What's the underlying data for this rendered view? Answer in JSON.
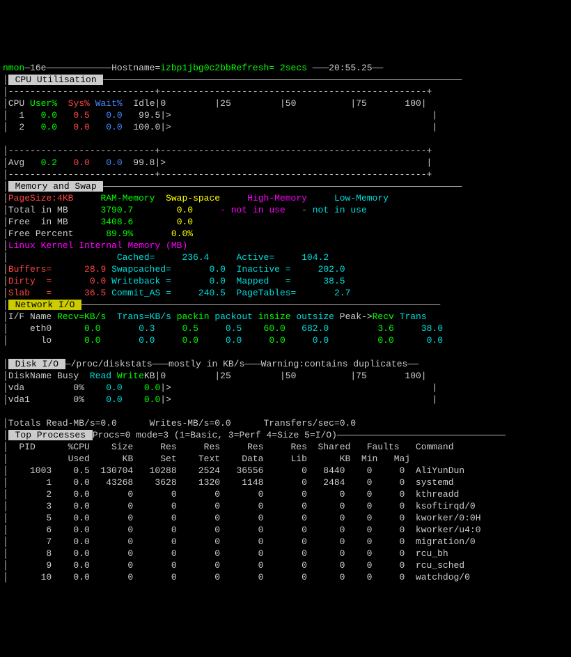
{
  "header": {
    "prog": "nmon",
    "ver": "—16e",
    "hostlabel": "Hostname=",
    "host": "izbp1jbg0c2bbRefresh= 2secs",
    "time": "20:55.25"
  },
  "cpu_box_title": " CPU Utilisation ",
  "cpu_cols": {
    "c1": "CPU",
    "c2": "User%",
    "c3": "Sys%",
    "c4": "Wait%",
    "c5": "Idle"
  },
  "cpu_rows": [
    {
      "cpu": "  1",
      "user": "0.0",
      "sys": "0.5",
      "wait": "0.0",
      "idle": "99.5"
    },
    {
      "cpu": "  2",
      "user": "0.0",
      "sys": "0.0",
      "wait": "0.0",
      "idle": "100.0"
    }
  ],
  "cpu_avg": {
    "label": "Avg",
    "user": "0.2",
    "sys": "0.0",
    "wait": "0.0",
    "idle": "99.8"
  },
  "cpu_scale": "|0         |25         |50          |75       100|",
  "mem_box_title": " Memory and Swap ",
  "mem": {
    "pagesize": "PageSize:4KB",
    "ram_label": "RAM-Memory",
    "swap_label": "Swap-space",
    "high_label": "High-Memory",
    "low_label": "Low-Memory",
    "total_label": "Total in MB",
    "total_ram": "3790.7",
    "total_swap": "0.0",
    "hnote": "- not in use",
    "lnote": "- not in use",
    "free_label": "Free  in MB",
    "free_ram": "3408.6",
    "free_swap": "0.0",
    "freep_label": "Free Percent",
    "freep_ram": "89.9%",
    "freep_swap": "0.0%",
    "kernel_label": "Linux Kernel Internal Memory (MB)",
    "cached_l": "Cached=",
    "cached_v": "236.4",
    "active_l": "Active=",
    "active_v": "104.2",
    "buffers_l": "Buffers=",
    "buffers_v": "28.9",
    "swapcached_l": "Swapcached=",
    "swapcached_v": "0.0",
    "inactive_l": "Inactive =",
    "inactive_v": "202.0",
    "dirty_l": "Dirty  =",
    "dirty_v": "0.0",
    "writeback_l": "Writeback =",
    "writeback_v": "0.0",
    "mapped_l": "Mapped   =",
    "mapped_v": "38.5",
    "slab_l": "Slab   =",
    "slab_v": "36.5",
    "commit_l": "Commit_AS =",
    "commit_v": "240.5",
    "pagetab_l": "PageTables=",
    "pagetab_v": "2.7"
  },
  "net_box_title": " Network I/O ",
  "net_cols": {
    "c1": "I/F Name",
    "c2": "Recv=KB/s",
    "c3": "Trans=KB/s",
    "c4": "packin",
    "c5": "packout",
    "c6": "insize",
    "c7": "outsize",
    "c8": "Peak->",
    "c9": "Recv",
    "c10": "Trans"
  },
  "net_rows": [
    {
      "if": "    eth0",
      "recv": "0.0",
      "trans": "0.3",
      "pin": "0.5",
      "pout": "0.5",
      "insz": "60.0",
      "outsz": "682.0",
      "precv": "3.6",
      "ptrans": "38.0"
    },
    {
      "if": "      lo",
      "recv": "0.0",
      "trans": "0.0",
      "pin": "0.0",
      "pout": "0.0",
      "insz": "0.0",
      "outsz": "0.0",
      "precv": "0.0",
      "ptrans": "0.0"
    }
  ],
  "disk_box_title": " Disk I/O ",
  "disk_suffix": "—/proc/diskstats———mostly in KB/s———Warning:contains duplicates——",
  "disk_cols": {
    "c1": "DiskName",
    "c2": "Busy",
    "c3": "Read",
    "c4": "Write",
    "c5": "KB"
  },
  "disk_rows": [
    {
      "name": "vda",
      "busy": "0%",
      "read": "0.0",
      "write": "0.0"
    },
    {
      "name": "vda1",
      "busy": "0%",
      "read": "0.0",
      "write": "0.0"
    }
  ],
  "disk_totals": "Totals Read-MB/s=0.0      Writes-MB/s=0.0      Transfers/sec=0.0",
  "proc_box_title": " Top Processes ",
  "proc_suffix": "Procs=0 mode=3 (1=Basic, 3=Perf 4=Size 5=I/O)",
  "proc_hdr1": "  PID      %CPU    Size     Res     Res     Res     Res  Shared   Faults   Command",
  "proc_hdr2": "           Used      KB     Set    Text    Data     Lib      KB  Min   Maj",
  "procs": [
    {
      "pid": "    1003",
      "cpu": "0.5",
      "size": "130704",
      "set": "10288",
      "text": "2524",
      "data": "36556",
      "lib": "0",
      "shared": "8440",
      "min": "0",
      "maj": "0",
      "cmd": "AliYunDun"
    },
    {
      "pid": "       1",
      "cpu": "0.0",
      "size": "43268",
      "set": "3628",
      "text": "1320",
      "data": "1148",
      "lib": "0",
      "shared": "2484",
      "min": "0",
      "maj": "0",
      "cmd": "systemd"
    },
    {
      "pid": "       2",
      "cpu": "0.0",
      "size": "0",
      "set": "0",
      "text": "0",
      "data": "0",
      "lib": "0",
      "shared": "0",
      "min": "0",
      "maj": "0",
      "cmd": "kthreadd"
    },
    {
      "pid": "       3",
      "cpu": "0.0",
      "size": "0",
      "set": "0",
      "text": "0",
      "data": "0",
      "lib": "0",
      "shared": "0",
      "min": "0",
      "maj": "0",
      "cmd": "ksoftirqd/0"
    },
    {
      "pid": "       5",
      "cpu": "0.0",
      "size": "0",
      "set": "0",
      "text": "0",
      "data": "0",
      "lib": "0",
      "shared": "0",
      "min": "0",
      "maj": "0",
      "cmd": "kworker/0:0H"
    },
    {
      "pid": "       6",
      "cpu": "0.0",
      "size": "0",
      "set": "0",
      "text": "0",
      "data": "0",
      "lib": "0",
      "shared": "0",
      "min": "0",
      "maj": "0",
      "cmd": "kworker/u4:0"
    },
    {
      "pid": "       7",
      "cpu": "0.0",
      "size": "0",
      "set": "0",
      "text": "0",
      "data": "0",
      "lib": "0",
      "shared": "0",
      "min": "0",
      "maj": "0",
      "cmd": "migration/0"
    },
    {
      "pid": "       8",
      "cpu": "0.0",
      "size": "0",
      "set": "0",
      "text": "0",
      "data": "0",
      "lib": "0",
      "shared": "0",
      "min": "0",
      "maj": "0",
      "cmd": "rcu_bh"
    },
    {
      "pid": "       9",
      "cpu": "0.0",
      "size": "0",
      "set": "0",
      "text": "0",
      "data": "0",
      "lib": "0",
      "shared": "0",
      "min": "0",
      "maj": "0",
      "cmd": "rcu_sched"
    },
    {
      "pid": "      10",
      "cpu": "0.0",
      "size": "0",
      "set": "0",
      "text": "0",
      "data": "0",
      "lib": "0",
      "shared": "0",
      "min": "0",
      "maj": "0",
      "cmd": "watchdog/0"
    }
  ]
}
